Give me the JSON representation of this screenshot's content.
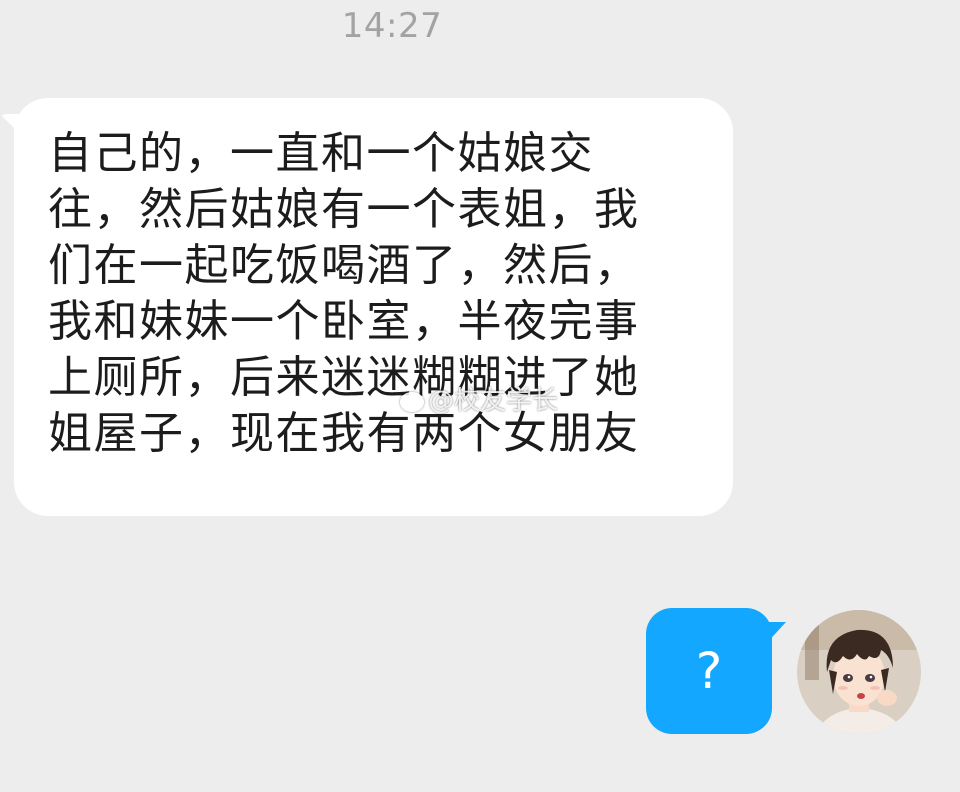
{
  "header": {
    "time": "14:27"
  },
  "messages": [
    {
      "direction": "incoming",
      "lines": [
        "自己的，一直和一个姑娘交",
        "往，然后姑娘有一个表姐，我",
        "们在一起吃饭喝酒了，然后，",
        "我和妹妹一个卧室，半夜完事",
        "上厕所，后来迷迷糊糊进了她",
        "姐屋子，现在我有两个女朋友"
      ]
    },
    {
      "direction": "outgoing",
      "text": "?",
      "avatar_icon": "anime-boy-avatar"
    }
  ],
  "watermark": {
    "text": "@校友学长",
    "icon": "weibo-icon"
  },
  "colors": {
    "background": "#ededed",
    "incoming_bubble": "#ffffff",
    "outgoing_bubble": "#13a7ff",
    "timestamp": "#a3a3a3"
  }
}
